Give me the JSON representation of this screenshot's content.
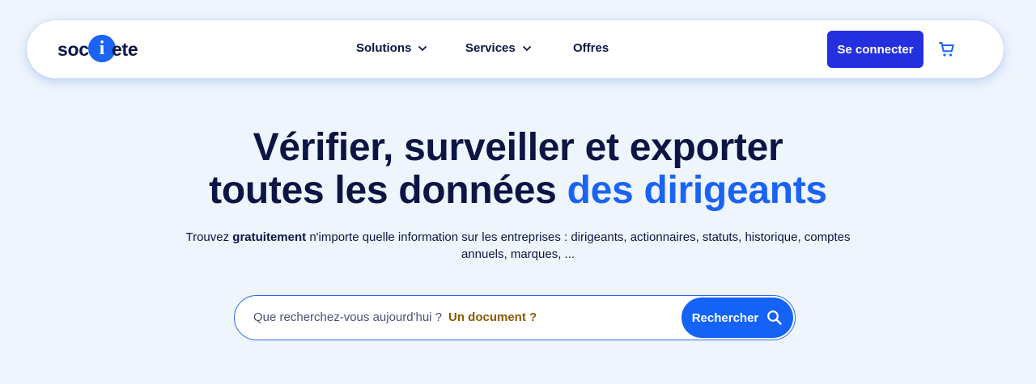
{
  "header": {
    "logo": {
      "left_text": "soc",
      "mark_letter": "i",
      "right_text": "ete"
    },
    "nav": {
      "solutions_label": "Solutions",
      "services_label": "Services",
      "offres_label": "Offres"
    },
    "login_label": "Se connecter",
    "cart_icon": "cart-icon"
  },
  "hero": {
    "title_line1": "Vérifier, surveiller et exporter",
    "title_line2_plain": "toutes les données",
    "title_line2_accent": "des dirigeants",
    "subtitle_prefix": "Trouvez",
    "subtitle_bold": "gratuitement",
    "subtitle_rest": "n'importe quelle information sur les entreprises : dirigeants, actionnaires, statuts, historique, comptes annuels, marques, ..."
  },
  "search": {
    "placeholder_main": "Que recherchez-vous aujourd'hui ?",
    "placeholder_accent": "Un document ?",
    "button_label": "Rechercher",
    "button_icon": "search-icon"
  },
  "colors": {
    "background": "#eef5fc",
    "brand_blue": "#1a63f5",
    "login_button": "#2430e0",
    "dark_text": "#0d1545",
    "placeholder_accent": "#8a5a00"
  }
}
